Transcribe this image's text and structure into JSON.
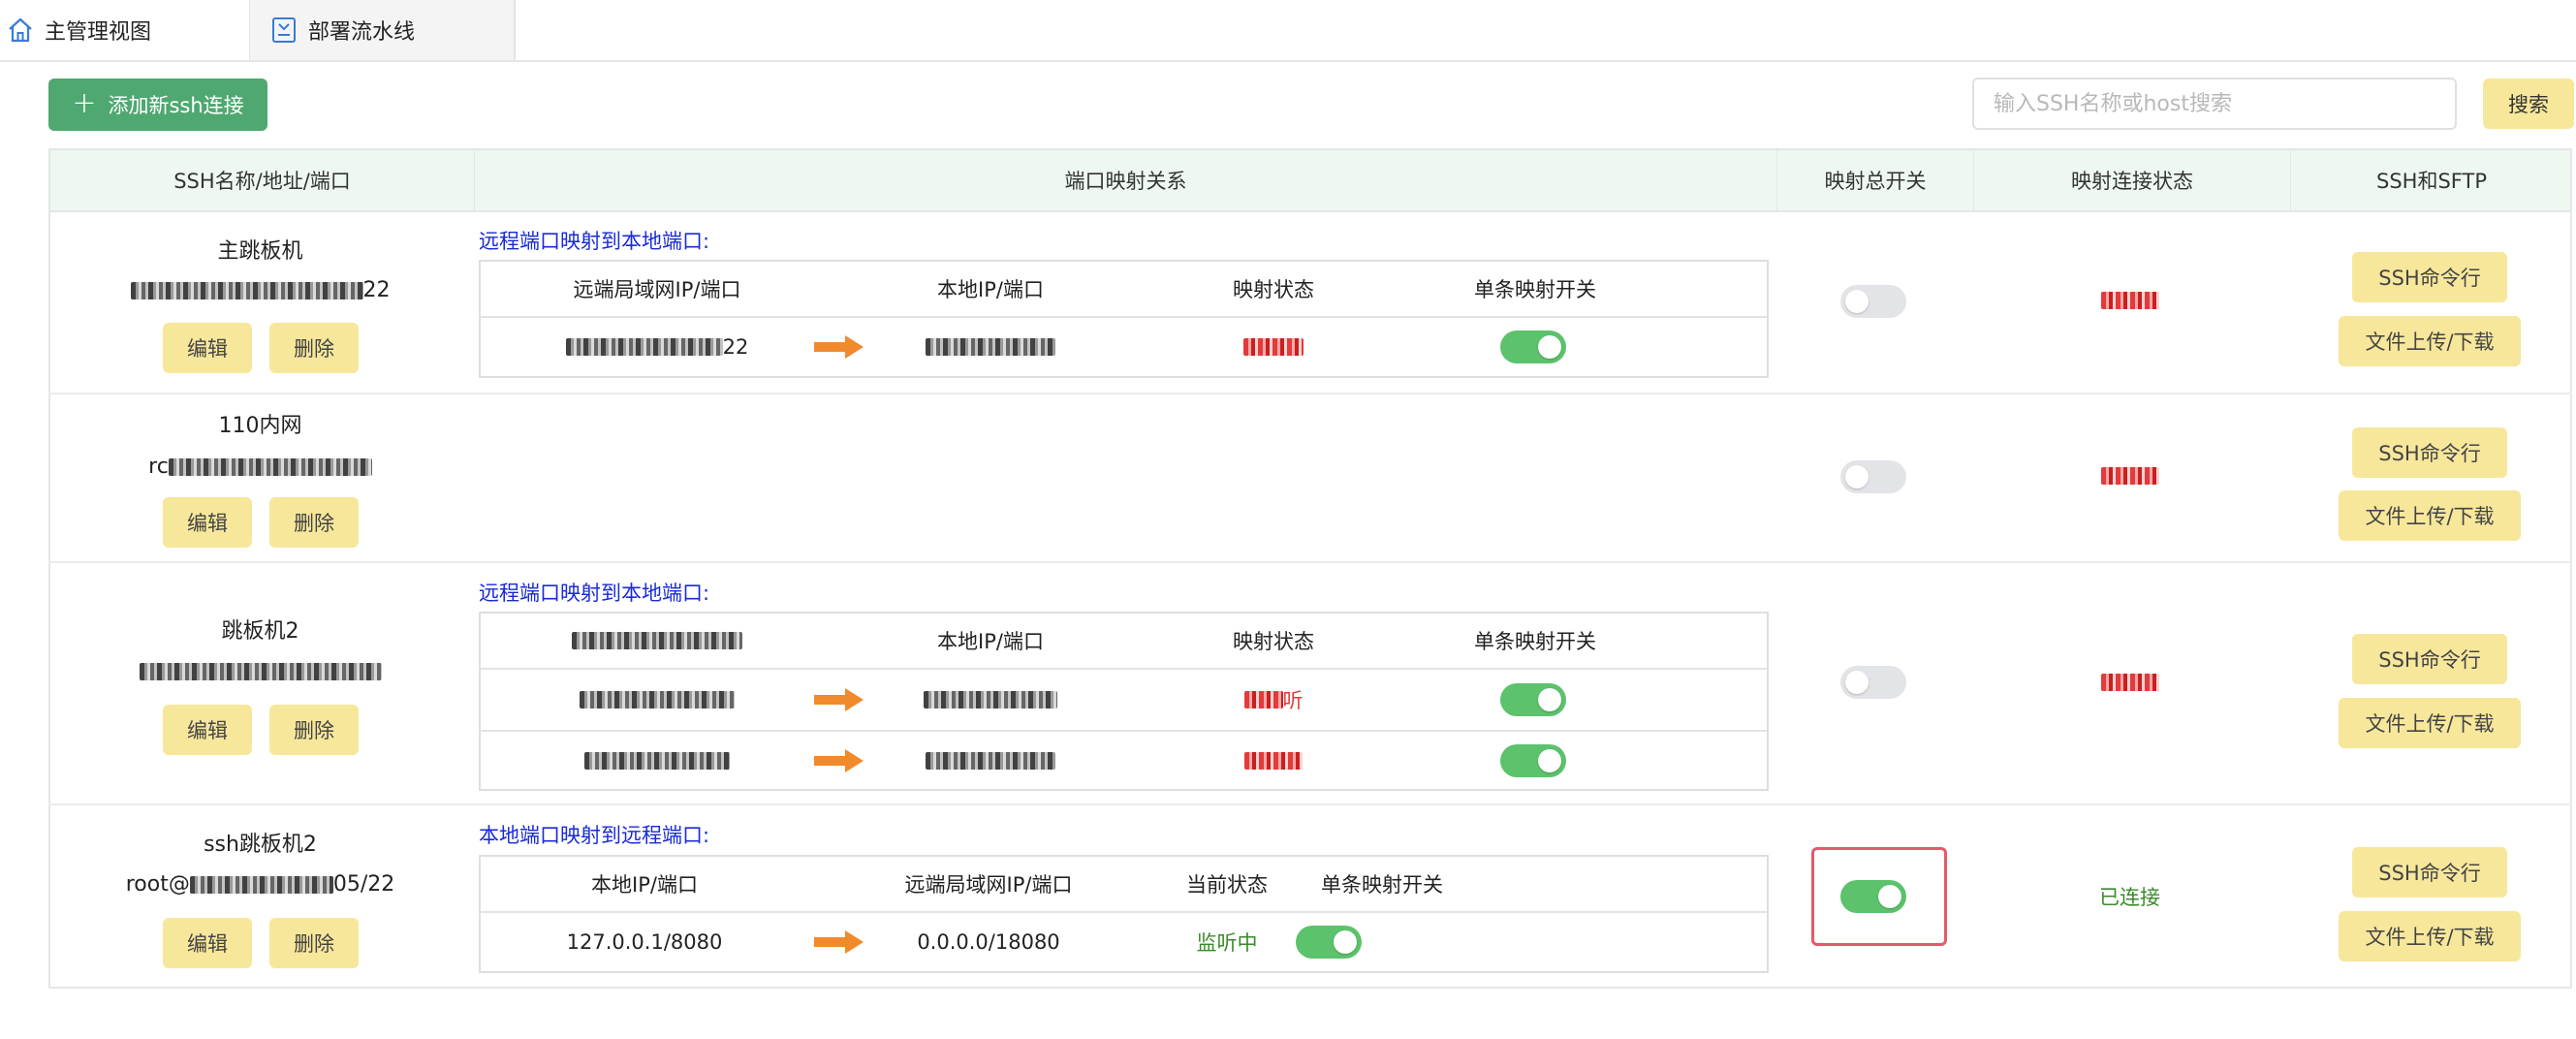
{
  "tabs": [
    {
      "label": "主管理视图",
      "icon": "home-icon",
      "active": true
    },
    {
      "label": "部署流水线",
      "icon": "pipeline-icon",
      "active": false
    }
  ],
  "toolbar": {
    "add_label": "添加新ssh连接",
    "search_placeholder": "输入SSH名称或host搜索",
    "search_label": "搜索"
  },
  "table": {
    "headers": [
      "SSH名称/地址/端口",
      "端口映射关系",
      "映射总开关",
      "映射连接状态",
      "SSH和SFTP"
    ],
    "edit_label": "编辑",
    "delete_label": "删除",
    "ssh_label": "SSH命令行",
    "file_label": "文件上传/下载"
  },
  "rows": [
    {
      "name": "主跳板机",
      "address_suffix": "22",
      "mapping_title": "远程端口映射到本地端口:",
      "mapping_headers": [
        "远端局域网IP/端口",
        "本地IP/端口",
        "映射状态",
        "单条映射开关"
      ],
      "mappings": [
        {
          "remote_suffix": "22",
          "status_suffix": "",
          "enabled": true
        }
      ],
      "master_switch": false
    },
    {
      "name": "110内网",
      "address_prefix": "rc",
      "master_switch": false
    },
    {
      "name": "跳板机2",
      "mapping_title": "远程端口映射到本地端口:",
      "mapping_headers": [
        "远端局域网IP/端口",
        "本地IP/端口",
        "映射状态",
        "单条映射开关"
      ],
      "mappings": [
        {
          "status_suffix": "听",
          "enabled": true
        },
        {
          "status_suffix": "",
          "enabled": true
        }
      ],
      "master_switch": false
    },
    {
      "name": "ssh跳板机2",
      "address_prefix": "root@",
      "address_suffix": "05/22",
      "mapping_title": "本地端口映射到远程端口:",
      "mapping_headers": [
        "本地IP/端口",
        "远端局域网IP/端口",
        "当前状态",
        "单条映射开关"
      ],
      "mappings": [
        {
          "local": "127.0.0.1/8080",
          "remote": "0.0.0.0/18080",
          "status": "监听中",
          "enabled": true
        }
      ],
      "master_switch": true,
      "connection_status": "已连接"
    }
  ],
  "colors": {
    "primary": "#4fa870",
    "button_yellow": "#f7e79b",
    "switch_on": "#5cc26c",
    "switch_off": "#e3e4e8",
    "link_blue": "#1a2bd6",
    "success_green": "#3a8a2a",
    "highlight_red": "#e45a6b"
  }
}
